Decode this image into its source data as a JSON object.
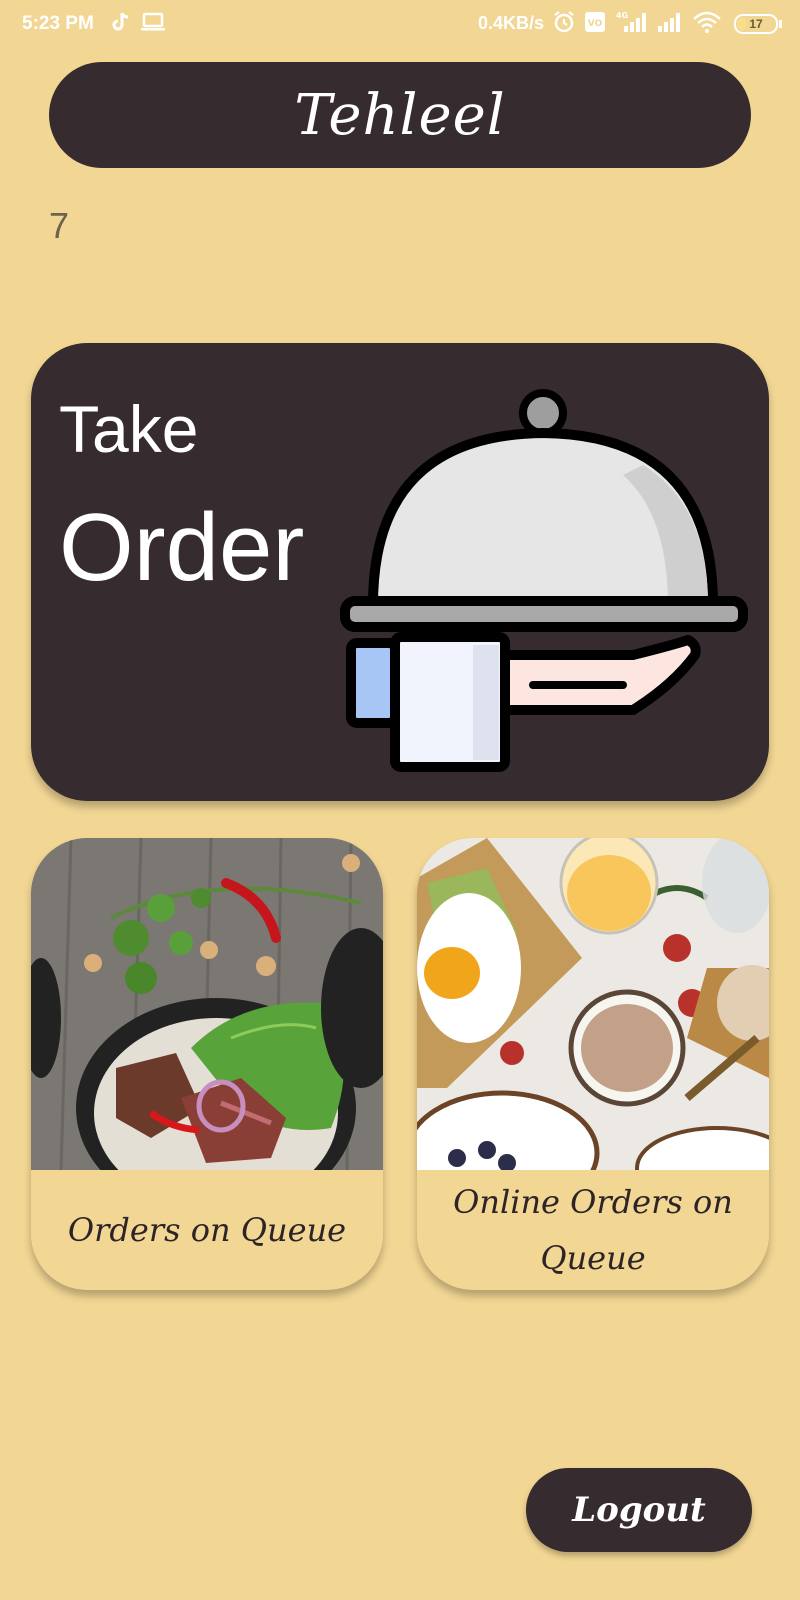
{
  "status_bar": {
    "time": "5:23 PM",
    "network_speed": "0.4KB/s",
    "battery_level": "17",
    "network_type": "4G",
    "icons_left": [
      "tiktok-icon",
      "laptop-icon"
    ],
    "icons_right": [
      "alarm-icon",
      "volte-icon",
      "signal-icon",
      "signal-icon",
      "wifi-icon",
      "battery-icon"
    ]
  },
  "header": {
    "title": "Tehleel"
  },
  "counter": "7",
  "take_order": {
    "line1": "Take",
    "line2": "Order",
    "icon": "serving-cloche-icon"
  },
  "cards": [
    {
      "caption": "Orders on Queue",
      "image": "steak-salad-photo"
    },
    {
      "caption": "Online Orders on Queue",
      "image": "breakfast-photo"
    }
  ],
  "logout_label": "Logout",
  "colors": {
    "background": "#f2d694",
    "dark": "#362b2e",
    "text_light": "#ffffff"
  }
}
